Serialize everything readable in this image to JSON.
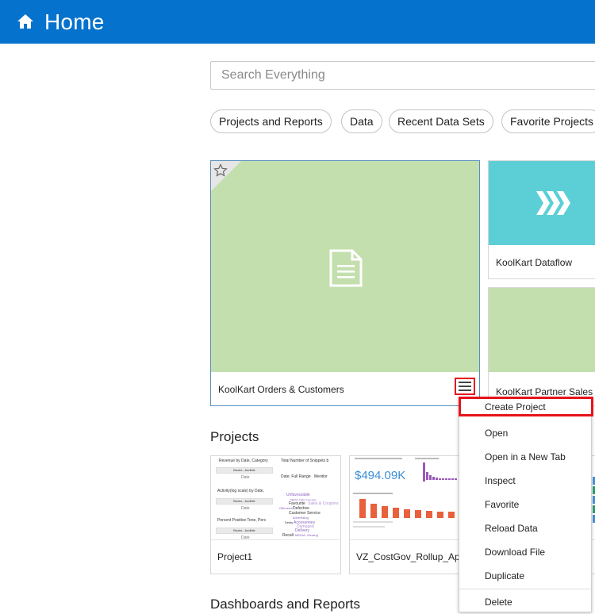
{
  "header": {
    "title": "Home",
    "icon": "home-icon"
  },
  "search": {
    "placeholder": "Search Everything",
    "value": ""
  },
  "filters": [
    "Projects and Reports",
    "Data",
    "Recent Data Sets",
    "Favorite Projects"
  ],
  "featured": [
    {
      "label": "KoolKart Orders & Customers",
      "icon": "document-icon",
      "color": "#c4dfae"
    },
    {
      "label": "KoolKart Dataflow",
      "icon": "dataflow-chevrons-icon",
      "color": "#5ccfd6"
    },
    {
      "label": "KoolKart Partner Sales",
      "icon": "",
      "color": "#c4dfae"
    }
  ],
  "sections": {
    "projects": "Projects",
    "dashboards": "Dashboards and Reports"
  },
  "projects": [
    {
      "label": "Project1",
      "thumb": {
        "title1": "Revenue by Date, Category",
        "chip1": "Books , Audible",
        "axis1": "Date",
        "title2": "Activity(log scale) by Date,",
        "chip2": "Books , Audible",
        "axis2": "Date",
        "title3": "Percent Positive Tone, Perc",
        "chip3": "Books , Audible",
        "axis3": "Date",
        "kpi_title": "Total Number of Snippets b",
        "filter": "Date: Full Range",
        "filter2": "Mentior",
        "words": [
          "Unfavourable",
          "MEDIA: Fallen Favourite",
          "Favourite",
          "Sales & Coupons",
          "Offensive",
          "Defective",
          "Customer Service",
          "Advertising",
          "Delay",
          "Accessories",
          "Damaged",
          "Delivery",
          "Recall",
          "MEDIA: Viewing"
        ]
      }
    },
    {
      "label": "VZ_CostGov_Rollup_Ap",
      "thumb": {
        "kpi": "$494.09K"
      }
    }
  ],
  "context_menu": {
    "items": [
      "Create Project",
      "Open",
      "Open in a New Tab",
      "Inspect",
      "Favorite",
      "Reload Data",
      "Download File",
      "Duplicate"
    ],
    "danger": "Delete",
    "highlight": "#e8131a"
  },
  "colors": {
    "brand": "#0572ce",
    "highlight": "#e8131a"
  }
}
